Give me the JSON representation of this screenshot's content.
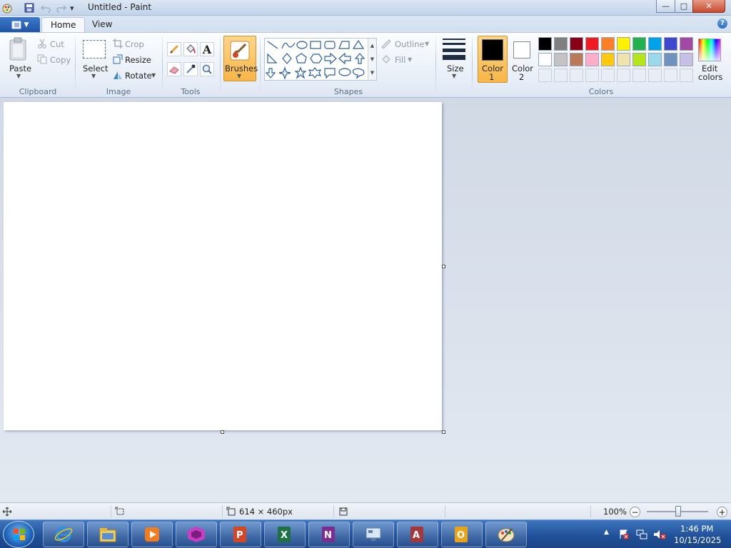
{
  "window": {
    "title": "Untitled - Paint",
    "controls": {
      "minimize": "—",
      "maximize": "□",
      "close": "✕"
    }
  },
  "qat": {
    "customize_glyph": "▾"
  },
  "tabs": {
    "home": "Home",
    "view": "View",
    "help": "?"
  },
  "ribbon": {
    "clipboard": {
      "paste": "Paste",
      "cut": "Cut",
      "copy": "Copy",
      "group": "Clipboard"
    },
    "image": {
      "select": "Select",
      "crop": "Crop",
      "resize": "Resize",
      "rotate": "Rotate",
      "group": "Image"
    },
    "tools": {
      "text_glyph": "A",
      "group": "Tools"
    },
    "brushes": {
      "label": "Brushes"
    },
    "shapes": {
      "outline": "Outline",
      "fill": "Fill",
      "group": "Shapes"
    },
    "size": {
      "label": "Size"
    },
    "colors": {
      "color1_line1": "Color",
      "color1_line2": "1",
      "color2_line1": "Color",
      "color2_line2": "2",
      "edit_line1": "Edit",
      "edit_line2": "colors",
      "group": "Colors",
      "color1_value": "#000000",
      "color2_value": "#ffffff",
      "palette_row1": [
        "#000000",
        "#7f7f7f",
        "#880015",
        "#ed1c24",
        "#ff7f27",
        "#fff200",
        "#22b14c",
        "#00a2e8",
        "#3f48cc",
        "#a349a4"
      ],
      "palette_row2": [
        "#ffffff",
        "#c3c3c3",
        "#b97a57",
        "#ffaec9",
        "#ffc90e",
        "#efe4b0",
        "#b5e61d",
        "#99d9ea",
        "#7092be",
        "#c8bfe7"
      ]
    }
  },
  "status": {
    "canvas_size": "614 × 460px",
    "zoom": "100%",
    "zoom_out": "−",
    "zoom_in": "+"
  },
  "tray": {
    "time": "1:46 PM",
    "date": "10/15/2025"
  }
}
